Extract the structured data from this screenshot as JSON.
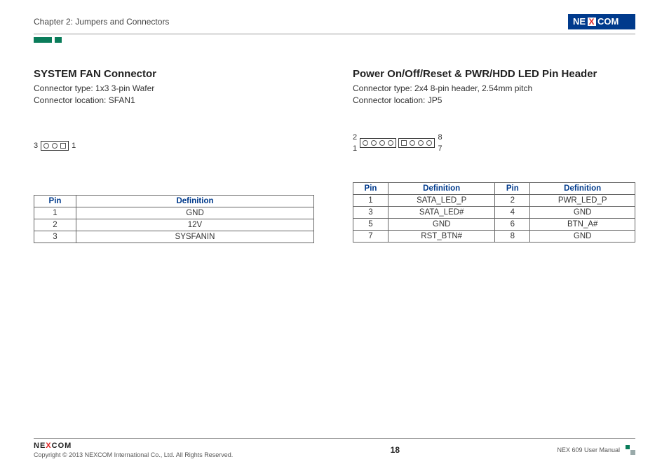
{
  "header": {
    "chapter": "Chapter 2: Jumpers and Connectors",
    "brand": "NEXCOM"
  },
  "left": {
    "title": "SYSTEM FAN Connector",
    "type_line": "Connector type: 1x3 3-pin Wafer",
    "loc_line": "Connector location: SFAN1",
    "diagram": {
      "left_label": "3",
      "right_label": "1"
    },
    "table": {
      "headers": [
        "Pin",
        "Definition"
      ],
      "rows": [
        [
          "1",
          "GND"
        ],
        [
          "2",
          "12V"
        ],
        [
          "3",
          "SYSFANIN"
        ]
      ]
    }
  },
  "right": {
    "title": "Power On/Off/Reset & PWR/HDD LED Pin Header",
    "type_line": "Connector type: 2x4 8-pin header, 2.54mm pitch",
    "loc_line": "Connector location: JP5",
    "diagram": {
      "top_left": "2",
      "top_right": "8",
      "bot_left": "1",
      "bot_right": "7"
    },
    "table": {
      "headers": [
        "Pin",
        "Definition",
        "Pin",
        "Definition"
      ],
      "rows": [
        [
          "1",
          "SATA_LED_P",
          "2",
          "PWR_LED_P"
        ],
        [
          "3",
          "SATA_LED#",
          "4",
          "GND"
        ],
        [
          "5",
          "GND",
          "6",
          "BTN_A#"
        ],
        [
          "7",
          "RST_BTN#",
          "8",
          "GND"
        ]
      ]
    }
  },
  "footer": {
    "logo": "NEXCOM",
    "copyright": "Copyright © 2013 NEXCOM International Co., Ltd. All Rights Reserved.",
    "page": "18",
    "doc": "NEX 609 User Manual"
  }
}
